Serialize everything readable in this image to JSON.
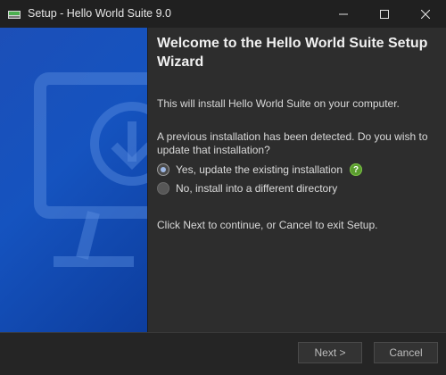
{
  "window": {
    "title": "Setup - Hello World Suite 9.0",
    "icon": "installer-icon",
    "controls": [
      "minimize-icon",
      "maximize-icon",
      "close-icon"
    ]
  },
  "banner": {
    "graphic": "monitor-download-icon"
  },
  "content": {
    "heading": "Welcome to the Hello World Suite Setup Wizard",
    "intro": "This will install Hello World Suite on your computer.",
    "question": "A previous installation has been detected. Do you wish to update that installation?",
    "options": [
      {
        "label": "Yes, update the existing installation",
        "selected": true,
        "help_icon": "help-icon"
      },
      {
        "label": "No, install into a different directory",
        "selected": false
      }
    ],
    "continue_text": "Click Next to continue, or Cancel to exit Setup."
  },
  "buttons": {
    "next": "Next >",
    "cancel": "Cancel"
  },
  "colors": {
    "banner": "#1553bf",
    "help_icon": "#5a9d2e",
    "background": "#2d2d2d"
  }
}
